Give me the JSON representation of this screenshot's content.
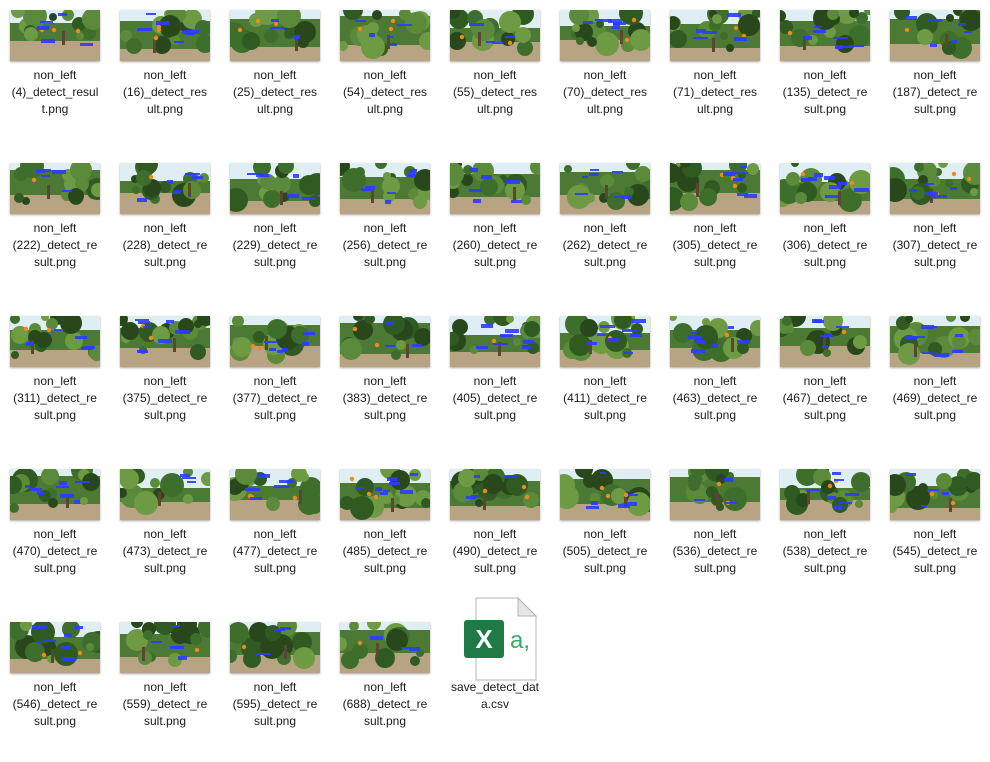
{
  "files": [
    {
      "line1": "non_left",
      "line2": "(4)_detect_resul",
      "line3": "t.png"
    },
    {
      "line1": "non_left",
      "line2": "(16)_detect_res",
      "line3": "ult.png"
    },
    {
      "line1": "non_left",
      "line2": "(25)_detect_res",
      "line3": "ult.png"
    },
    {
      "line1": "non_left",
      "line2": "(54)_detect_res",
      "line3": "ult.png"
    },
    {
      "line1": "non_left",
      "line2": "(55)_detect_res",
      "line3": "ult.png"
    },
    {
      "line1": "non_left",
      "line2": "(70)_detect_res",
      "line3": "ult.png"
    },
    {
      "line1": "non_left",
      "line2": "(71)_detect_res",
      "line3": "ult.png"
    },
    {
      "line1": "non_left",
      "line2": "(135)_detect_re",
      "line3": "sult.png"
    },
    {
      "line1": "non_left",
      "line2": "(187)_detect_re",
      "line3": "sult.png"
    },
    {
      "line1": "non_left",
      "line2": "(222)_detect_re",
      "line3": "sult.png"
    },
    {
      "line1": "non_left",
      "line2": "(228)_detect_re",
      "line3": "sult.png"
    },
    {
      "line1": "non_left",
      "line2": "(229)_detect_re",
      "line3": "sult.png"
    },
    {
      "line1": "non_left",
      "line2": "(256)_detect_re",
      "line3": "sult.png"
    },
    {
      "line1": "non_left",
      "line2": "(260)_detect_re",
      "line3": "sult.png"
    },
    {
      "line1": "non_left",
      "line2": "(262)_detect_re",
      "line3": "sult.png"
    },
    {
      "line1": "non_left",
      "line2": "(305)_detect_re",
      "line3": "sult.png"
    },
    {
      "line1": "non_left",
      "line2": "(306)_detect_re",
      "line3": "sult.png"
    },
    {
      "line1": "non_left",
      "line2": "(307)_detect_re",
      "line3": "sult.png"
    },
    {
      "line1": "non_left",
      "line2": "(311)_detect_re",
      "line3": "sult.png"
    },
    {
      "line1": "non_left",
      "line2": "(375)_detect_re",
      "line3": "sult.png"
    },
    {
      "line1": "non_left",
      "line2": "(377)_detect_re",
      "line3": "sult.png"
    },
    {
      "line1": "non_left",
      "line2": "(383)_detect_re",
      "line3": "sult.png"
    },
    {
      "line1": "non_left",
      "line2": "(405)_detect_re",
      "line3": "sult.png"
    },
    {
      "line1": "non_left",
      "line2": "(411)_detect_re",
      "line3": "sult.png"
    },
    {
      "line1": "non_left",
      "line2": "(463)_detect_re",
      "line3": "sult.png"
    },
    {
      "line1": "non_left",
      "line2": "(467)_detect_re",
      "line3": "sult.png"
    },
    {
      "line1": "non_left",
      "line2": "(469)_detect_re",
      "line3": "sult.png"
    },
    {
      "line1": "non_left",
      "line2": "(470)_detect_re",
      "line3": "sult.png"
    },
    {
      "line1": "non_left",
      "line2": "(473)_detect_re",
      "line3": "sult.png"
    },
    {
      "line1": "non_left",
      "line2": "(477)_detect_re",
      "line3": "sult.png"
    },
    {
      "line1": "non_left",
      "line2": "(485)_detect_re",
      "line3": "sult.png"
    },
    {
      "line1": "non_left",
      "line2": "(490)_detect_re",
      "line3": "sult.png"
    },
    {
      "line1": "non_left",
      "line2": "(505)_detect_re",
      "line3": "sult.png"
    },
    {
      "line1": "non_left",
      "line2": "(536)_detect_re",
      "line3": "sult.png"
    },
    {
      "line1": "non_left",
      "line2": "(538)_detect_re",
      "line3": "sult.png"
    },
    {
      "line1": "non_left",
      "line2": "(545)_detect_re",
      "line3": "sult.png"
    },
    {
      "line1": "non_left",
      "line2": "(546)_detect_re",
      "line3": "sult.png"
    },
    {
      "line1": "non_left",
      "line2": "(559)_detect_re",
      "line3": "sult.png"
    },
    {
      "line1": "non_left",
      "line2": "(595)_detect_re",
      "line3": "sult.png"
    },
    {
      "line1": "non_left",
      "line2": "(688)_detect_re",
      "line3": "sult.png"
    }
  ],
  "csv_file": {
    "line1": "save_detect_dat",
    "line2": "a.csv",
    "icon": "excel-csv-icon",
    "icon_letters": "X",
    "icon_glyph": "a,"
  },
  "colors": {
    "excel_green": "#1f7a45",
    "excel_dark": "#107c41",
    "detection_box": "#2a3cff",
    "foliage": "#3f6b2e",
    "sky": "#cfe6f5",
    "soil": "#b9a68a"
  }
}
